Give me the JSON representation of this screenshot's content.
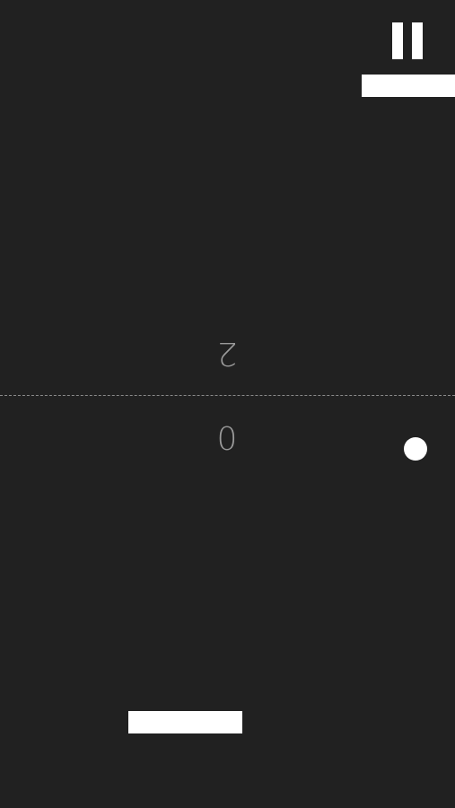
{
  "game": {
    "background_color": "#212121",
    "foreground_color": "#ffffff",
    "score_color": "#9a9a9a",
    "controls": {
      "pause_icon": "pause-icon"
    },
    "scores": {
      "opponent": "2",
      "player": "0"
    }
  }
}
